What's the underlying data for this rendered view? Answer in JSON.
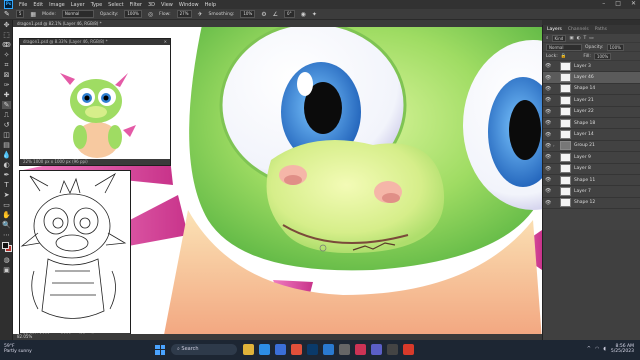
{
  "menu": {
    "items": [
      "File",
      "Edit",
      "Image",
      "Layer",
      "Type",
      "Select",
      "Filter",
      "3D",
      "View",
      "Window",
      "Help"
    ],
    "logo": "Ps"
  },
  "options": {
    "brush_size": "5",
    "mode_label": "Mode:",
    "mode_value": "Normal",
    "opacity_label": "Opacity:",
    "opacity_value": "100%",
    "flow_label": "Flow:",
    "flow_value": "27%",
    "smoothing_label": "Smoothing:",
    "smoothing_value": "10%",
    "angle_value": "0°"
  },
  "doc": {
    "tab_title": "dragon1.psd @ 82.1% (Layer 46, RGB/8) *",
    "zoom_status": "82.05%",
    "nav_window_title": "dragon1.psd @ 8.33% (Layer 46, RGB/8) *",
    "nav_status": "22%",
    "nav_status_detail": "1000 px x 1000 px (96 ppi)",
    "sketch_status": "30.69%",
    "sketch_status_detail": "1000 px x 1000 px (96 ppi)"
  },
  "layers": {
    "tabs": [
      "Layers",
      "Channels",
      "Paths"
    ],
    "kind_label": "Kind",
    "blend": "Normal",
    "opacity_label": "Opacity:",
    "opacity_value": "100%",
    "lock_label": "Lock:",
    "fill_label": "Fill:",
    "fill_value": "100%",
    "rows": [
      {
        "name": "Layer 3",
        "type": "layer",
        "selected": false
      },
      {
        "name": "Layer 46",
        "type": "layer",
        "selected": true
      },
      {
        "name": "Shape 14",
        "type": "layer",
        "selected": false
      },
      {
        "name": "Layer 21",
        "type": "layer",
        "selected": false
      },
      {
        "name": "Layer 22",
        "type": "layer",
        "selected": false
      },
      {
        "name": "Shape 18",
        "type": "layer",
        "selected": false
      },
      {
        "name": "Layer 14",
        "type": "layer",
        "selected": false
      },
      {
        "name": "Group 21",
        "type": "group",
        "selected": false
      },
      {
        "name": "Layer 9",
        "type": "layer",
        "selected": false
      },
      {
        "name": "Layer 8",
        "type": "layer",
        "selected": false
      },
      {
        "name": "Shape 11",
        "type": "layer",
        "selected": false
      },
      {
        "name": "Layer 7",
        "type": "layer",
        "selected": false
      },
      {
        "name": "Shape 12",
        "type": "layer",
        "selected": false
      }
    ]
  },
  "taskbar": {
    "weather_temp": "59°F",
    "weather_desc": "Partly sunny",
    "search_label": "Search",
    "time": "8:56 AM",
    "date": "5/25/2023",
    "apps": [
      {
        "name": "Explorer",
        "color": "#e0b33a"
      },
      {
        "name": "Edge",
        "color": "#2d8ee6"
      },
      {
        "name": "Store",
        "color": "#3b6fd8"
      },
      {
        "name": "Chrome",
        "color": "#e0503a"
      },
      {
        "name": "Photoshop",
        "color": "#0a3a6a"
      },
      {
        "name": "Mail",
        "color": "#2a7ad0"
      },
      {
        "name": "Settings",
        "color": "#666666"
      },
      {
        "name": "Media",
        "color": "#cc3355"
      },
      {
        "name": "Teams",
        "color": "#5b5fc7"
      },
      {
        "name": "Camera",
        "color": "#444444"
      },
      {
        "name": "Acrobat",
        "color": "#d83a2a"
      }
    ]
  },
  "colors": {
    "dragon_green": "#9fdc63",
    "dragon_belly": "#f7c9a0",
    "fin_pink": "#e45aa6",
    "eye_blue": "#2f7fd0",
    "accent": "#31a8ff"
  }
}
